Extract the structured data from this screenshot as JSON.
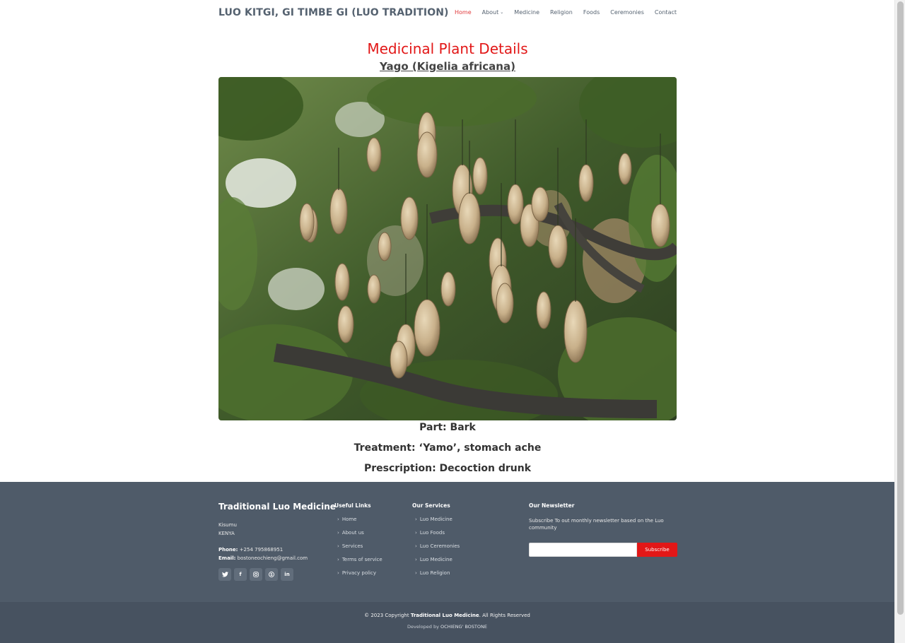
{
  "header": {
    "logo": "LUO KITGI, GI TIMBE GI (LUO TRADITION)",
    "nav": [
      "Home",
      "About",
      "Medicine",
      "Religion",
      "Foods",
      "Ceremonies",
      "Contact"
    ],
    "active": "Home"
  },
  "content": {
    "title": "Medicinal Plant Details",
    "plant_name": "Yago (Kigelia africana)",
    "part": "Part: Bark",
    "treatment": "Treatment: ‘Yamo’, stomach ache",
    "prescription": "Prescription: Decoction drunk"
  },
  "footer": {
    "brand": "Traditional Luo Medicine",
    "city": "Kisumu",
    "country": "KENYA",
    "phone_label": "Phone:",
    "phone": "+254 795868951",
    "email_label": "Email:",
    "email": "bostoneochieng@gmail.com",
    "socials": [
      "twitter-icon",
      "facebook-icon",
      "instagram-icon",
      "skype-icon",
      "linkedin-icon"
    ],
    "useful_links_title": "Useful Links",
    "useful_links": [
      "Home",
      "About us",
      "Services",
      "Terms of service",
      "Privacy policy"
    ],
    "services_title": "Our Services",
    "services": [
      "Luo Medicine",
      "Luo Foods",
      "Luo Ceremonies",
      "Luo Medicine",
      "Luo Religion"
    ],
    "newsletter_title": "Our Newsletter",
    "newsletter_text": "Subscribe To out monthly newsletter based on the Luo community",
    "subscribe_label": "Subscribe",
    "copyright_prefix": "© 2023 Copyright",
    "copyright_brand": "Traditional Luo Medicine",
    "copyright_suffix": ". All Rights Reserved",
    "developed_prefix": "Developed by",
    "developer": "OCHIENG' BOSTONE"
  },
  "colors": {
    "accent": "#e21717",
    "nav_text": "#556270",
    "footer_bg": "#4f5b69",
    "footer_bottom_bg": "#475260"
  }
}
